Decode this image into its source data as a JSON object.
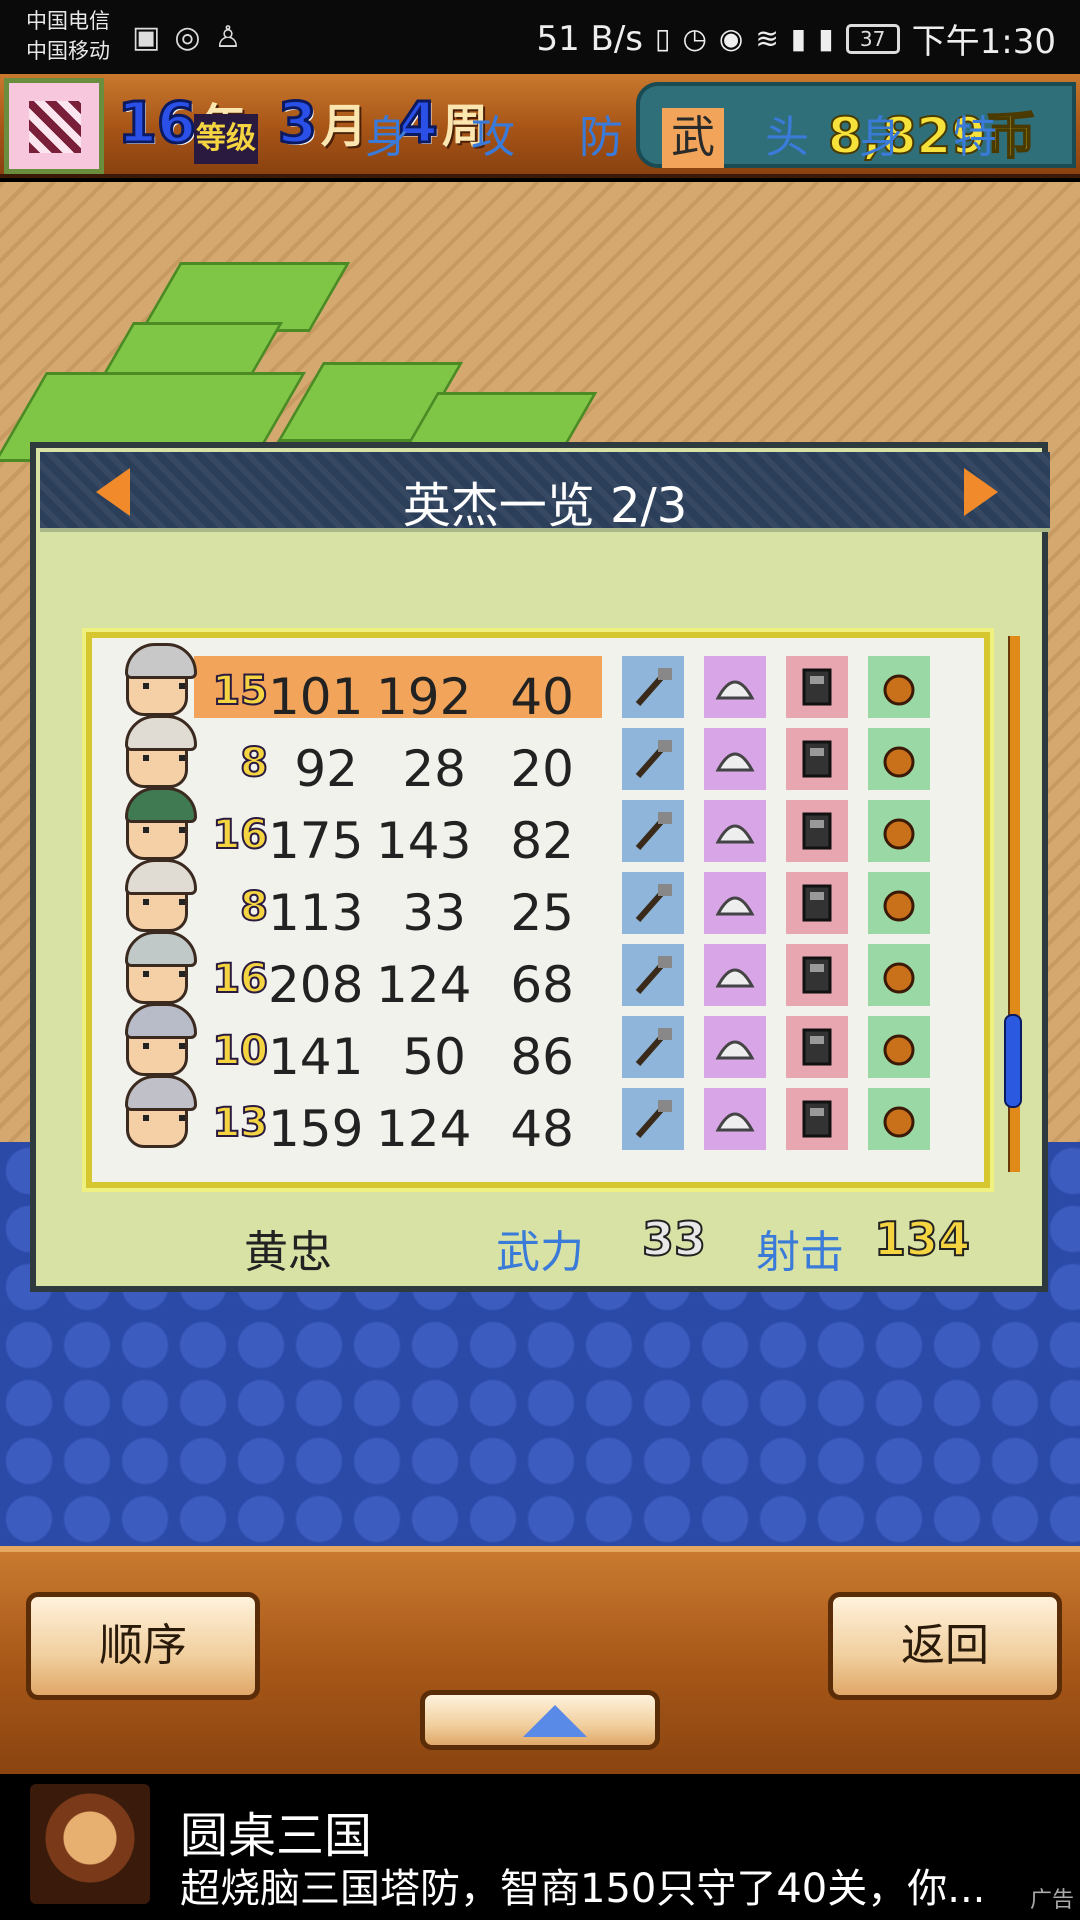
{
  "status_bar": {
    "carrier1": "中国电信",
    "carrier2": "中国移动",
    "speed": "51 B/s",
    "battery": "37",
    "time": "下午1:30"
  },
  "top_bar": {
    "year": "16",
    "year_unit": "年",
    "month": "3",
    "month_unit": "月",
    "week": "4",
    "week_unit": "周",
    "coins": "8,829币"
  },
  "panel": {
    "title": "英杰一览 2/3",
    "level_header": "等级",
    "columns": [
      "身",
      "攻",
      "防",
      "武",
      "头",
      "身",
      "特"
    ],
    "active_column": "武",
    "rows": [
      {
        "level": "15",
        "s1": "101",
        "s2": "192",
        "s3": "40",
        "hair": "#c8c8c8"
      },
      {
        "level": "8",
        "s1": "92",
        "s2": "28",
        "s3": "20",
        "hair": "#e0dcd4"
      },
      {
        "level": "16",
        "s1": "175",
        "s2": "143",
        "s3": "82",
        "hair": "#3f7a52"
      },
      {
        "level": "8",
        "s1": "113",
        "s2": "33",
        "s3": "25",
        "hair": "#e0dcd4"
      },
      {
        "level": "16",
        "s1": "208",
        "s2": "124",
        "s3": "68",
        "hair": "#c0c8c8"
      },
      {
        "level": "10",
        "s1": "141",
        "s2": "50",
        "s3": "86",
        "hair": "#b8bcc8"
      },
      {
        "level": "13",
        "s1": "159",
        "s2": "124",
        "s3": "48",
        "hair": "#c0c0c8"
      }
    ],
    "selected_row": 0,
    "footer": {
      "name": "黄忠",
      "label1": "武力",
      "value1": "33",
      "label2": "射击",
      "value2": "134"
    }
  },
  "buttons": {
    "order": "顺序",
    "back": "返回"
  },
  "ad": {
    "title": "圆桌三国",
    "desc": "超烧脑三国塔防，智商150只守了40关，你...",
    "tag": "广告"
  },
  "colors": {
    "highlight": "#f1a45a",
    "header_blue": "#3a7ad8",
    "gold": "#f4d440"
  }
}
